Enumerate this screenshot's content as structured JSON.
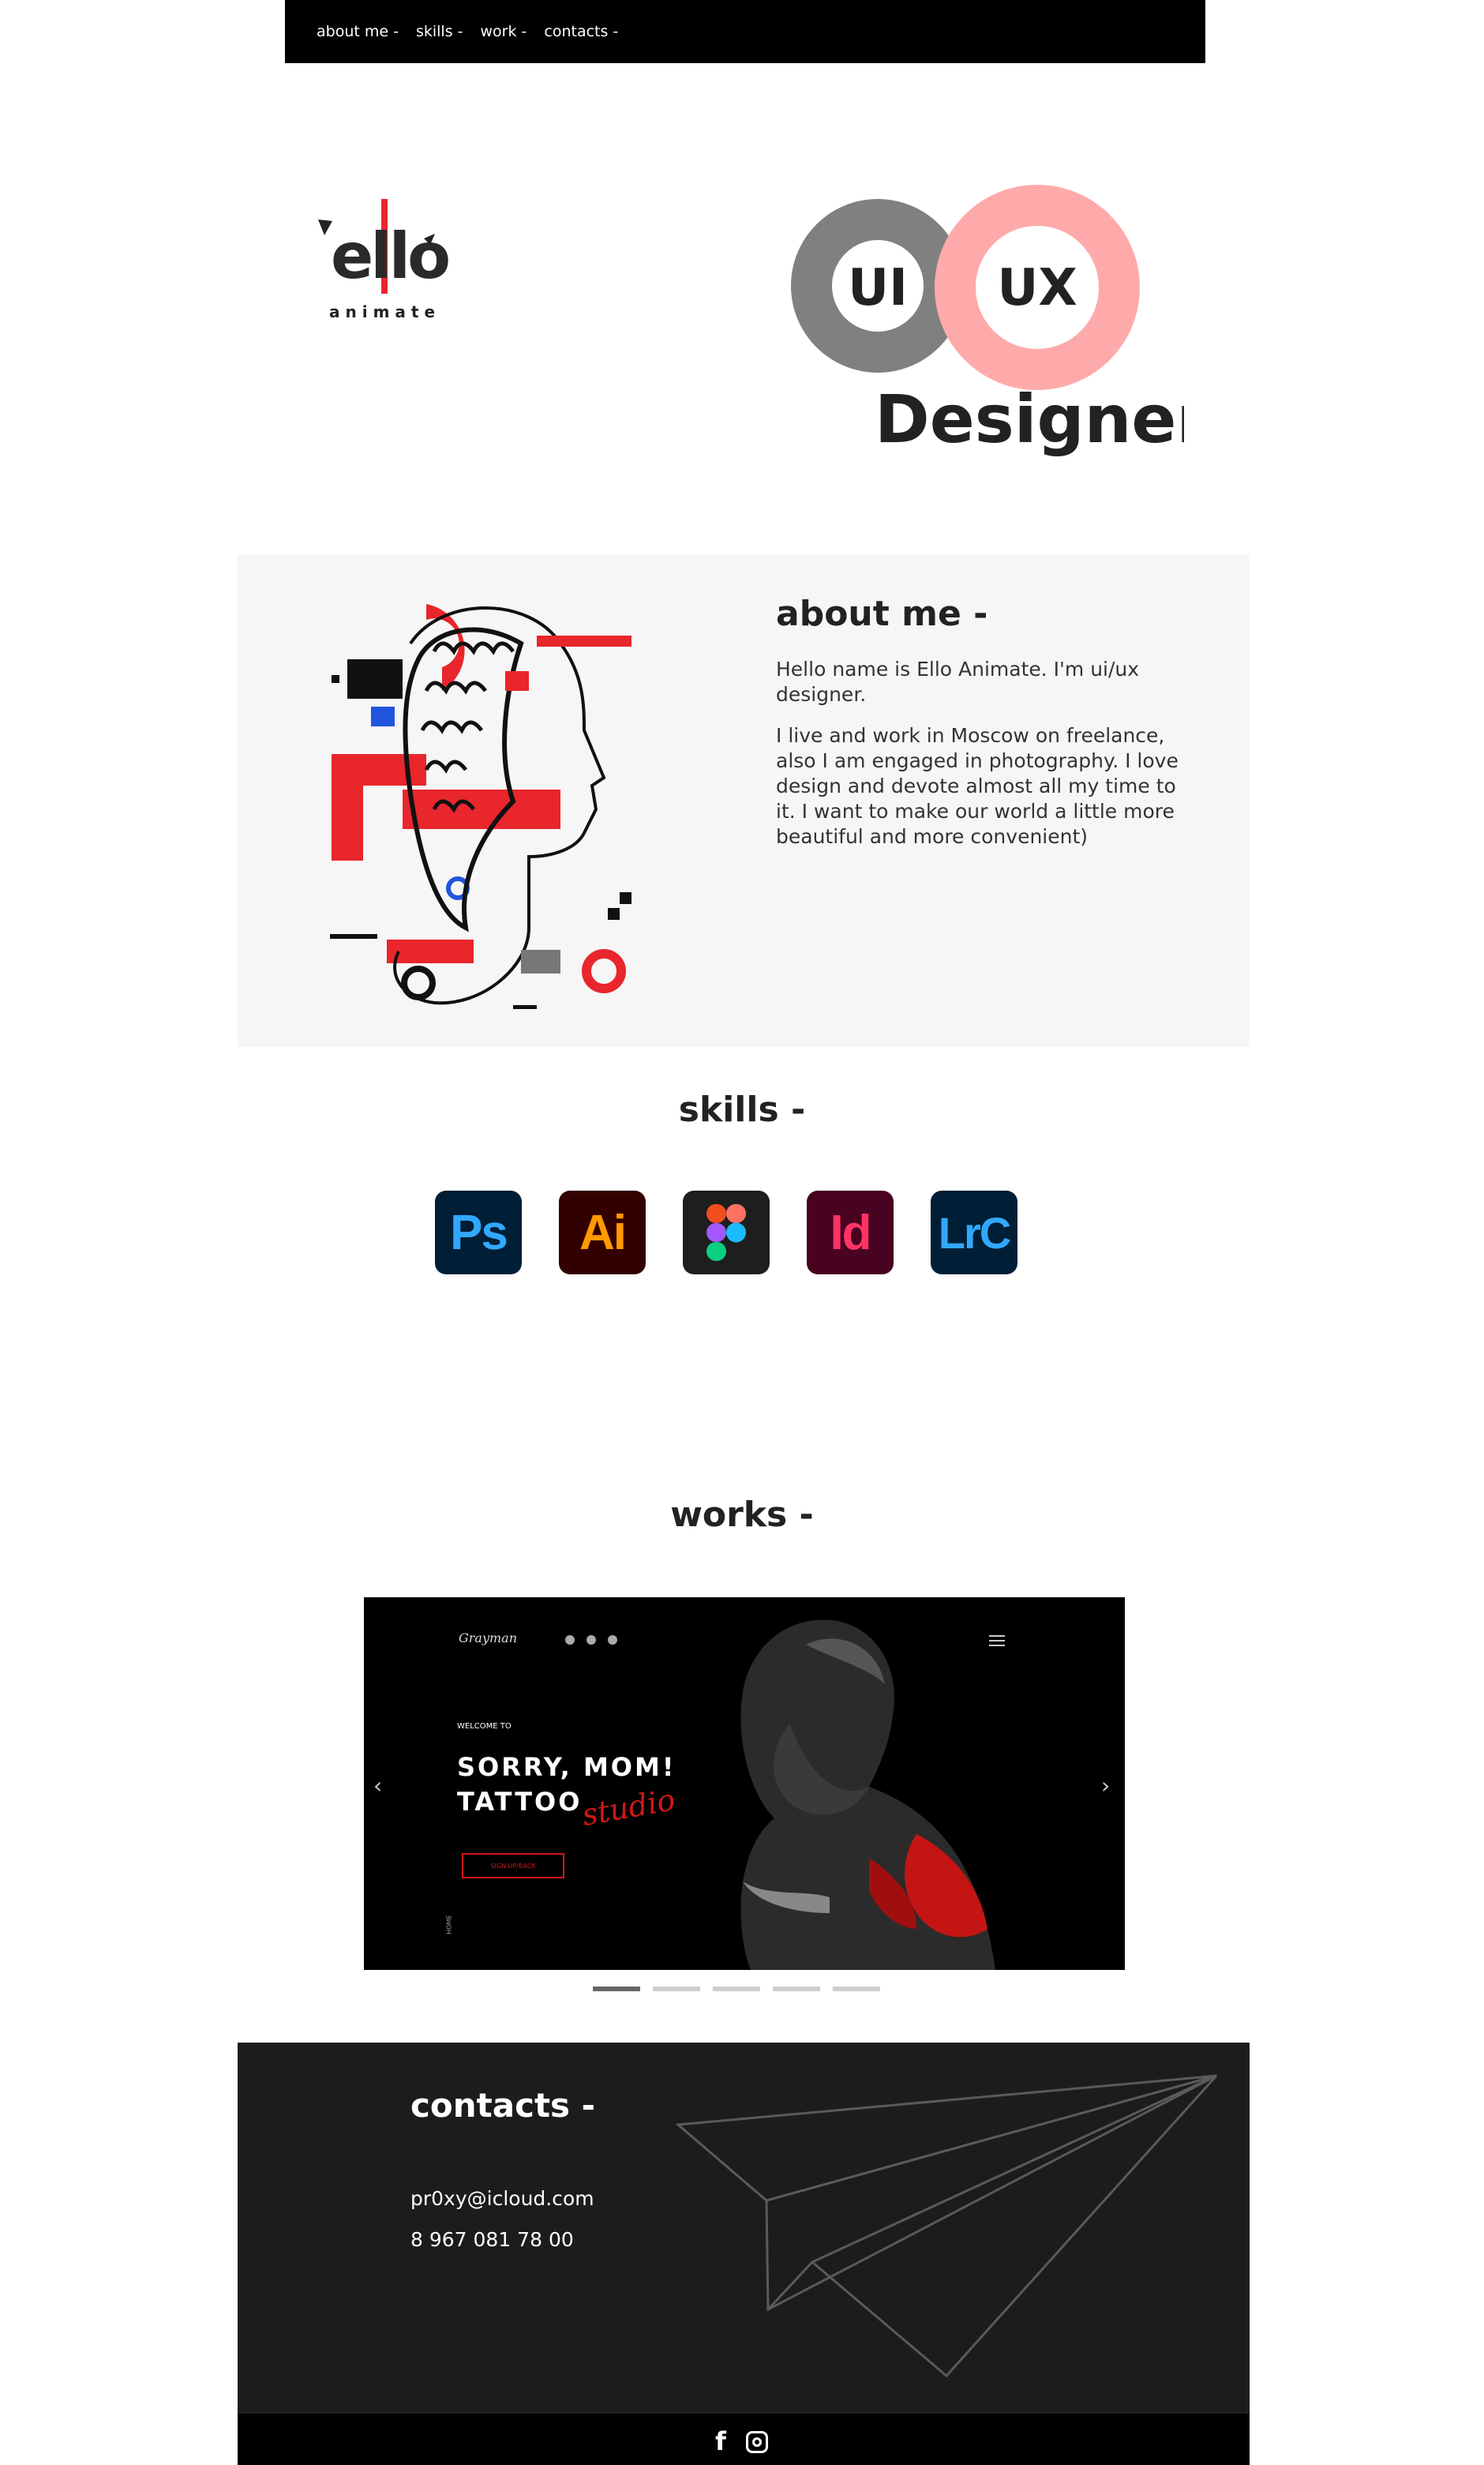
{
  "nav": {
    "items": [
      "about me -",
      "skills -",
      "work -",
      "contacts -"
    ]
  },
  "hero": {
    "logo_text": "ello",
    "logo_sub": "animate",
    "ui_label": "UI",
    "ux_label": "UX",
    "designer_label": "Designer",
    "colors": {
      "ui_ring": "#808080",
      "ux_ring": "#ffaaaa",
      "logo_red": "#e8262c"
    }
  },
  "about": {
    "title": "about me -",
    "paragraph1": "Hello name is Ello Animate. I'm ui/ux designer.",
    "paragraph2": "I live and work in Moscow on freelance, also I am engaged in photography. I love design and devote almost all my time to it. I want to make our world a little more beautiful and more convenient)"
  },
  "skills": {
    "title": "skills -",
    "items": [
      {
        "label": "Ps",
        "name": "photoshop-icon",
        "bg": "#001e36",
        "fg": "#31a8ff"
      },
      {
        "label": "Ai",
        "name": "illustrator-icon",
        "bg": "#330000",
        "fg": "#ff9a00"
      },
      {
        "label": "",
        "name": "figma-icon",
        "bg": "#1e1e1e",
        "fg": "#ffffff"
      },
      {
        "label": "Id",
        "name": "indesign-icon",
        "bg": "#49021f",
        "fg": "#ff3366"
      },
      {
        "label": "LrC",
        "name": "lightroom-classic-icon",
        "bg": "#001e36",
        "fg": "#31a8ff"
      }
    ]
  },
  "works": {
    "title": "works -",
    "slide": {
      "brand": "Grayman",
      "welcome": "WELCOME TO",
      "headline1": "SORRY, MOM!",
      "headline2": "TATTOO",
      "script_word": "studio",
      "cta": "SIGN UP/BACK",
      "side_label": "HOME"
    },
    "dots": 5,
    "active_dot": 0
  },
  "contacts": {
    "title": "contacts -",
    "email": "pr0xy@icloud.com",
    "phone": "8 967 081 78 00"
  }
}
